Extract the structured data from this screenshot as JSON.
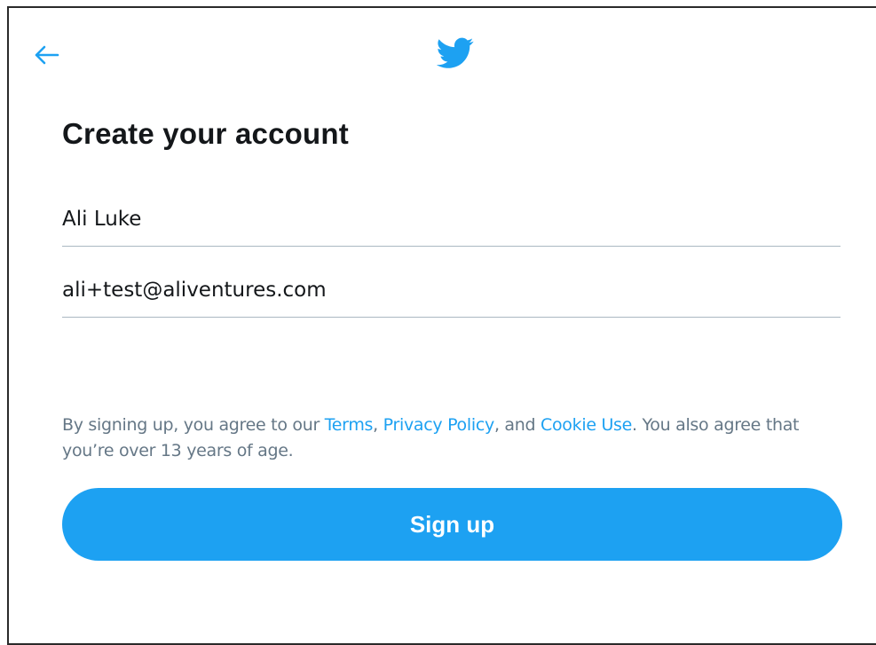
{
  "header": {
    "back_icon": "arrow-left-icon",
    "logo_icon": "twitter-bird-icon",
    "accent_color": "#1da1f2"
  },
  "form": {
    "title": "Create your account",
    "name_value": "Ali Luke",
    "email_value": "ali+test@aliventures.com"
  },
  "legal": {
    "prefix": "By signing up, you agree to our ",
    "terms_link": "Terms",
    "sep1": ", ",
    "privacy_link": "Privacy Policy",
    "sep2": ", and ",
    "cookie_link": "Cookie Use",
    "suffix": ". You also agree that you’re over 13 years of age."
  },
  "actions": {
    "signup_label": "Sign up"
  }
}
